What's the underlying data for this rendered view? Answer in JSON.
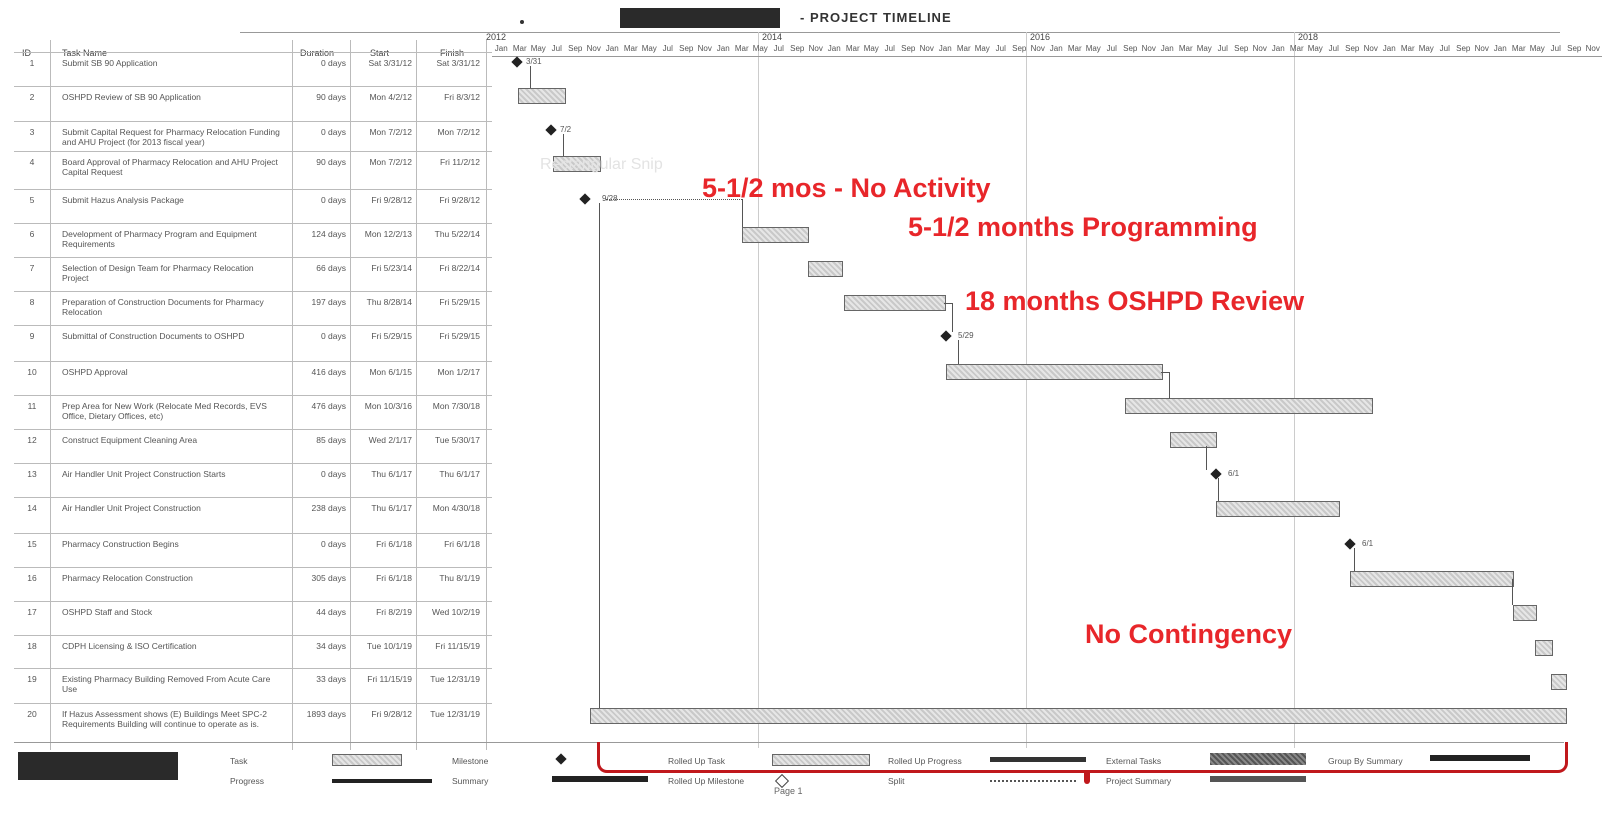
{
  "title": "- PROJECT TIMELINE",
  "columns": {
    "id": "ID",
    "name": "Task Name",
    "duration": "Duration",
    "start": "Start",
    "finish": "Finish"
  },
  "years": [
    "2012",
    "2014",
    "2016",
    "2018"
  ],
  "months": [
    "Jan",
    "Mar",
    "May",
    "Jul",
    "Sep",
    "Nov",
    "Jan",
    "Mar",
    "May",
    "Jul",
    "Sep",
    "Nov",
    "Jan",
    "Mar",
    "May",
    "Jul",
    "Sep",
    "Nov",
    "Jan",
    "Mar",
    "May",
    "Jul",
    "Sep",
    "Nov",
    "Jan",
    "Mar",
    "May",
    "Jul",
    "Sep",
    "Nov",
    "Jan",
    "Mar",
    "May",
    "Jul",
    "Sep",
    "Nov",
    "Jan",
    "Mar",
    "May",
    "Jul",
    "Sep",
    "Nov",
    "Jan",
    "Mar",
    "May",
    "Jul",
    "Sep",
    "Nov",
    "Jan",
    "Mar",
    "May",
    "Jul",
    "Sep",
    "Nov",
    "Jan",
    "Mar",
    "May",
    "Jul",
    "Sep",
    "Nov"
  ],
  "tasks": [
    {
      "id": "1",
      "name": "Submit SB 90 Application",
      "duration": "0 days",
      "start": "Sat 3/31/12",
      "finish": "Sat 3/31/12",
      "milestone_label": "3/31"
    },
    {
      "id": "2",
      "name": "OSHPD Review of SB 90 Application",
      "duration": "90 days",
      "start": "Mon 4/2/12",
      "finish": "Fri 8/3/12"
    },
    {
      "id": "3",
      "name": "Submit Capital Request for Pharmacy Relocation Funding and AHU Project (for 2013 fiscal year)",
      "duration": "0 days",
      "start": "Mon 7/2/12",
      "finish": "Mon 7/2/12",
      "milestone_label": "7/2"
    },
    {
      "id": "4",
      "name": "Board Approval of Pharmacy Relocation and AHU Project Capital Request",
      "duration": "90 days",
      "start": "Mon 7/2/12",
      "finish": "Fri 11/2/12"
    },
    {
      "id": "5",
      "name": "Submit Hazus Analysis Package",
      "duration": "0 days",
      "start": "Fri 9/28/12",
      "finish": "Fri 9/28/12",
      "milestone_label": "9/28"
    },
    {
      "id": "6",
      "name": "Development of Pharmacy Program and Equipment Requirements",
      "duration": "124 days",
      "start": "Mon 12/2/13",
      "finish": "Thu 5/22/14"
    },
    {
      "id": "7",
      "name": "Selection of Design Team for Pharmacy Relocation Project",
      "duration": "66 days",
      "start": "Fri 5/23/14",
      "finish": "Fri 8/22/14"
    },
    {
      "id": "8",
      "name": "Preparation of Construction Documents for Pharmacy Relocation",
      "duration": "197 days",
      "start": "Thu 8/28/14",
      "finish": "Fri 5/29/15"
    },
    {
      "id": "9",
      "name": "Submittal of Construction Documents to OSHPD",
      "duration": "0 days",
      "start": "Fri 5/29/15",
      "finish": "Fri 5/29/15",
      "milestone_label": "5/29"
    },
    {
      "id": "10",
      "name": "OSHPD Approval",
      "duration": "416 days",
      "start": "Mon 6/1/15",
      "finish": "Mon 1/2/17"
    },
    {
      "id": "11",
      "name": "Prep Area for New Work (Relocate Med Records, EVS Office, Dietary Offices, etc)",
      "duration": "476 days",
      "start": "Mon 10/3/16",
      "finish": "Mon 7/30/18"
    },
    {
      "id": "12",
      "name": "Construct Equipment Cleaning Area",
      "duration": "85 days",
      "start": "Wed 2/1/17",
      "finish": "Tue 5/30/17"
    },
    {
      "id": "13",
      "name": "Air Handler Unit Project Construction Starts",
      "duration": "0 days",
      "start": "Thu 6/1/17",
      "finish": "Thu 6/1/17",
      "milestone_label": "6/1"
    },
    {
      "id": "14",
      "name": "Air Handler Unit Project Construction",
      "duration": "238 days",
      "start": "Thu 6/1/17",
      "finish": "Mon 4/30/18"
    },
    {
      "id": "15",
      "name": "Pharmacy Construction Begins",
      "duration": "0 days",
      "start": "Fri 6/1/18",
      "finish": "Fri 6/1/18",
      "milestone_label": "6/1"
    },
    {
      "id": "16",
      "name": "Pharmacy Relocation Construction",
      "duration": "305 days",
      "start": "Fri 6/1/18",
      "finish": "Thu 8/1/19"
    },
    {
      "id": "17",
      "name": "OSHPD Staff and Stock",
      "duration": "44 days",
      "start": "Fri 8/2/19",
      "finish": "Wed 10/2/19"
    },
    {
      "id": "18",
      "name": "CDPH Licensing & ISO Certification",
      "duration": "34 days",
      "start": "Tue 10/1/19",
      "finish": "Fri 11/15/19"
    },
    {
      "id": "19",
      "name": "Existing Pharmacy Building Removed From Acute Care Use",
      "duration": "33 days",
      "start": "Fri 11/15/19",
      "finish": "Tue 12/31/19"
    },
    {
      "id": "20",
      "name": "If Hazus Assessment shows (E) Buildings Meet SPC-2 Requirements Building will continue to operate as is.",
      "duration": "1893 days",
      "start": "Fri 9/28/12",
      "finish": "Tue 12/31/19"
    }
  ],
  "annotations": {
    "no_activity": "5-1/2 mos - No Activity",
    "programming": "5-1/2 months Programming",
    "oshpd_review": "18 months OSHPD Review",
    "no_contingency": "No Contingency",
    "faint_watermark": "Rectangular Snip"
  },
  "legend": {
    "task": "Task",
    "progress": "Progress",
    "milestone": "Milestone",
    "summary": "Summary",
    "rolled_up_task": "Rolled Up Task",
    "rolled_up_milestone": "Rolled Up Milestone",
    "rolled_up_progress": "Rolled Up Progress",
    "split": "Split",
    "external_tasks": "External Tasks",
    "project_summary": "Project Summary",
    "group_by_summary": "Group By Summary"
  },
  "footer": "Page 1",
  "colors": {
    "annotation": "#e8262a",
    "bracket": "#c0181c"
  }
}
